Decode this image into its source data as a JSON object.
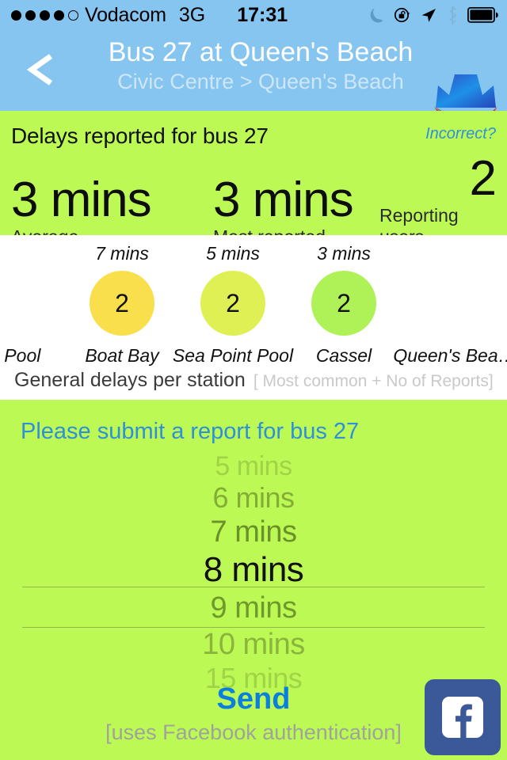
{
  "status_bar": {
    "signal_dots_filled": 4,
    "signal_dots_total": 5,
    "carrier": "Vodacom",
    "network": "3G",
    "time": "17:31",
    "icons": [
      "moon-icon",
      "rotation-lock-icon",
      "location-arrow-icon",
      "bluetooth-icon",
      "battery-icon"
    ]
  },
  "nav": {
    "back_label": "<",
    "title": "Bus 27 at Queen's Beach",
    "subtitle": "Civic Centre > Queen's Beach",
    "logo": "city-crown-logo"
  },
  "stats": {
    "title": "Delays reported for bus 27",
    "incorrect_link": "Incorrect?",
    "items": [
      {
        "value": "3 mins",
        "label": "Average"
      },
      {
        "value": "3 mins",
        "label": "Most reported"
      },
      {
        "value": "2",
        "label": "Reporting users"
      }
    ]
  },
  "stations": {
    "caption_main": "General delays per station",
    "caption_sub": "[ Most common + No of Reports]",
    "columns": [
      {
        "time": "",
        "count": "",
        "name": "f's Pool",
        "color": "transparent"
      },
      {
        "time": "7 mins",
        "count": "2",
        "name": "Boat Bay",
        "color": "#FADF4C"
      },
      {
        "time": "5 mins",
        "count": "2",
        "name": "Sea Point Pool",
        "color": "#DFF055"
      },
      {
        "time": "3 mins",
        "count": "2",
        "name": "Cassel",
        "color": "#AEF257"
      },
      {
        "time": "",
        "count": "",
        "name": "Queen's Bea…",
        "color": "transparent"
      }
    ]
  },
  "report": {
    "title": "Please submit a report for bus 27",
    "picker_options": [
      "5 mins",
      "6 mins",
      "7 mins",
      "8 mins",
      "9 mins",
      "10 mins",
      "15 mins"
    ],
    "picker_selected": "8 mins",
    "send_label": "Send",
    "send_note": "[uses Facebook authentication]",
    "facebook_button": "facebook-icon"
  },
  "colors": {
    "header_blue": "#86C5F0",
    "green": "#BCF955",
    "link_blue": "#2F90D8",
    "send_blue": "#0B7FE0",
    "facebook_blue": "#3B5998"
  }
}
